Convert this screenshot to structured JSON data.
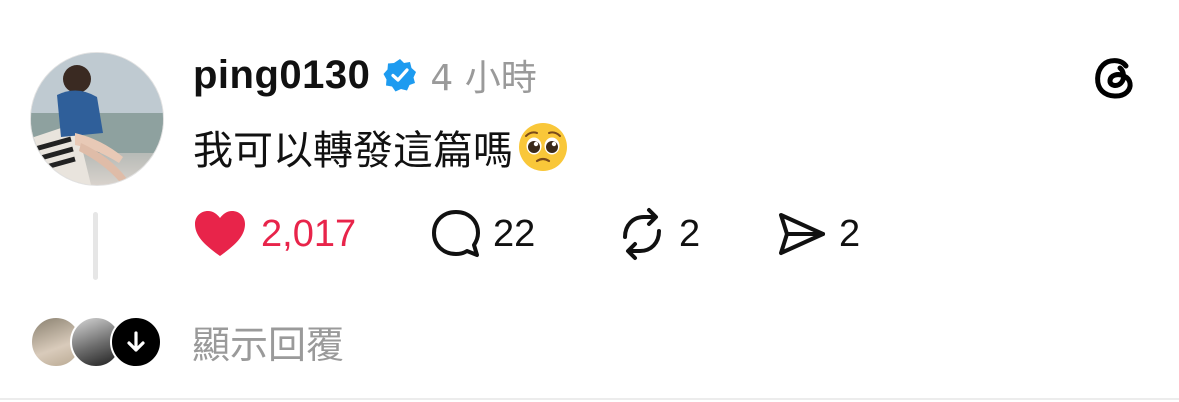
{
  "post": {
    "username": "ping0130",
    "time": "4 小時",
    "text": "我可以轉發這篇嗎",
    "text_emoji": "pleading-face"
  },
  "actions": {
    "likes": "2,017",
    "replies": "22",
    "reposts": "2",
    "shares": "2"
  },
  "colors": {
    "like": "#e8244a",
    "verified": "#1d9bf0",
    "muted": "#9a9a9a"
  },
  "footer": {
    "show_replies": "顯示回覆"
  }
}
